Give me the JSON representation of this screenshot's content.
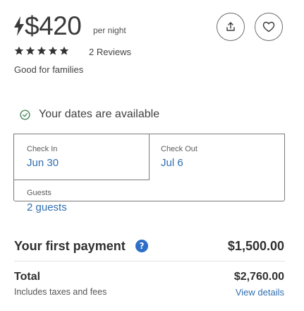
{
  "listing": {
    "price": "$420",
    "per_night": "per night",
    "rating": 5,
    "reviews": "2 Reviews",
    "tagline": "Good for families"
  },
  "actions": {
    "share_icon": "share-icon",
    "favorite_icon": "heart-icon"
  },
  "availability": {
    "icon": "check-circle-icon",
    "text": "Your dates are available"
  },
  "booking": {
    "check_in_label": "Check In",
    "check_in_value": "Jun 30",
    "check_out_label": "Check Out",
    "check_out_value": "Jul 6",
    "guests_label": "Guests",
    "guests_value": "2 guests"
  },
  "payment": {
    "first_payment_label": "Your first payment",
    "info_icon": "?",
    "first_payment_amount": "$1,500.00",
    "total_label": "Total",
    "total_amount": "$2,760.00",
    "taxes_note": "Includes taxes and fees",
    "view_details": "View details"
  },
  "colors": {
    "accent_blue": "#2f6fb1",
    "info_blue": "#2d6ec8",
    "availability_green": "#3f7f4e"
  }
}
